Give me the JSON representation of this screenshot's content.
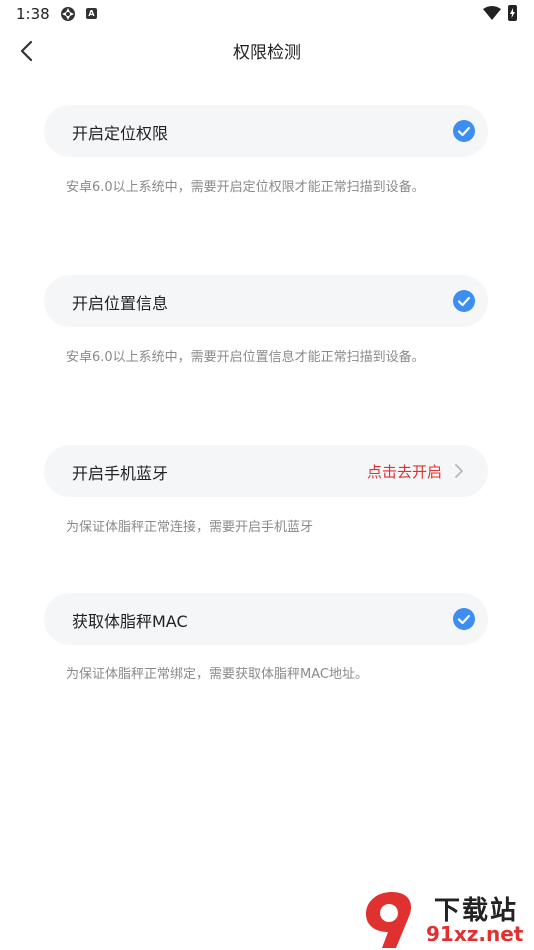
{
  "status_bar": {
    "time": "1:38",
    "notif_icon_a": "loader-icon",
    "notif_icon_b": "A"
  },
  "header": {
    "title": "权限检测",
    "back_icon": "chevron-left-icon"
  },
  "permissions": [
    {
      "label": "开启定位权限",
      "status": "checked",
      "description": "安卓6.0以上系统中，需要开启定位权限才能正常扫描到设备。"
    },
    {
      "label": "开启位置信息",
      "status": "checked",
      "description": "安卓6.0以上系统中，需要开启位置信息才能正常扫描到设备。"
    },
    {
      "label": "开启手机蓝牙",
      "status": "action",
      "action_label": "点击去开启",
      "description": "为保证体脂秤正常连接，需要开启手机蓝牙"
    },
    {
      "label": "获取体脂秤MAC",
      "status": "checked",
      "description": "为保证体脂秤正常绑定，需要获取体脂秤MAC地址。"
    }
  ],
  "watermark": {
    "top": "下载站",
    "bottom": "91xz.net"
  },
  "colors": {
    "check": "#3d8ef0",
    "action": "#e03131",
    "card_bg": "#f5f6f8",
    "desc": "#8a8a8a"
  }
}
